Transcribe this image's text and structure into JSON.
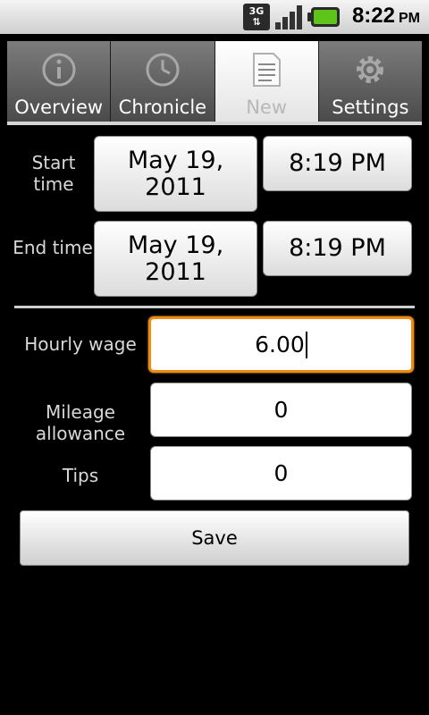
{
  "status_bar": {
    "network": "3G",
    "time": "8:22",
    "ampm": "PM",
    "icons": [
      "network-3g-icon",
      "signal-icon",
      "battery-charging-icon"
    ]
  },
  "tabs": [
    {
      "label": "Overview",
      "icon": "info-icon",
      "active": false
    },
    {
      "label": "Chronicle",
      "icon": "clock-icon",
      "active": false
    },
    {
      "label": "New",
      "icon": "document-icon",
      "active": true
    },
    {
      "label": "Settings",
      "icon": "gear-icon",
      "active": false
    }
  ],
  "form": {
    "start": {
      "label": "Start time",
      "date": "May 19, 2011",
      "time": "8:19 PM"
    },
    "end": {
      "label": "End time",
      "date": "May 19, 2011",
      "time": "8:19 PM"
    },
    "hourly_wage": {
      "label": "Hourly wage",
      "value": "6.00"
    },
    "mileage": {
      "label": "Mileage allowance",
      "value": "0"
    },
    "tips": {
      "label": "Tips",
      "value": "0"
    },
    "save_label": "Save"
  },
  "colors": {
    "focus": "#f08a10",
    "background": "#000000"
  }
}
